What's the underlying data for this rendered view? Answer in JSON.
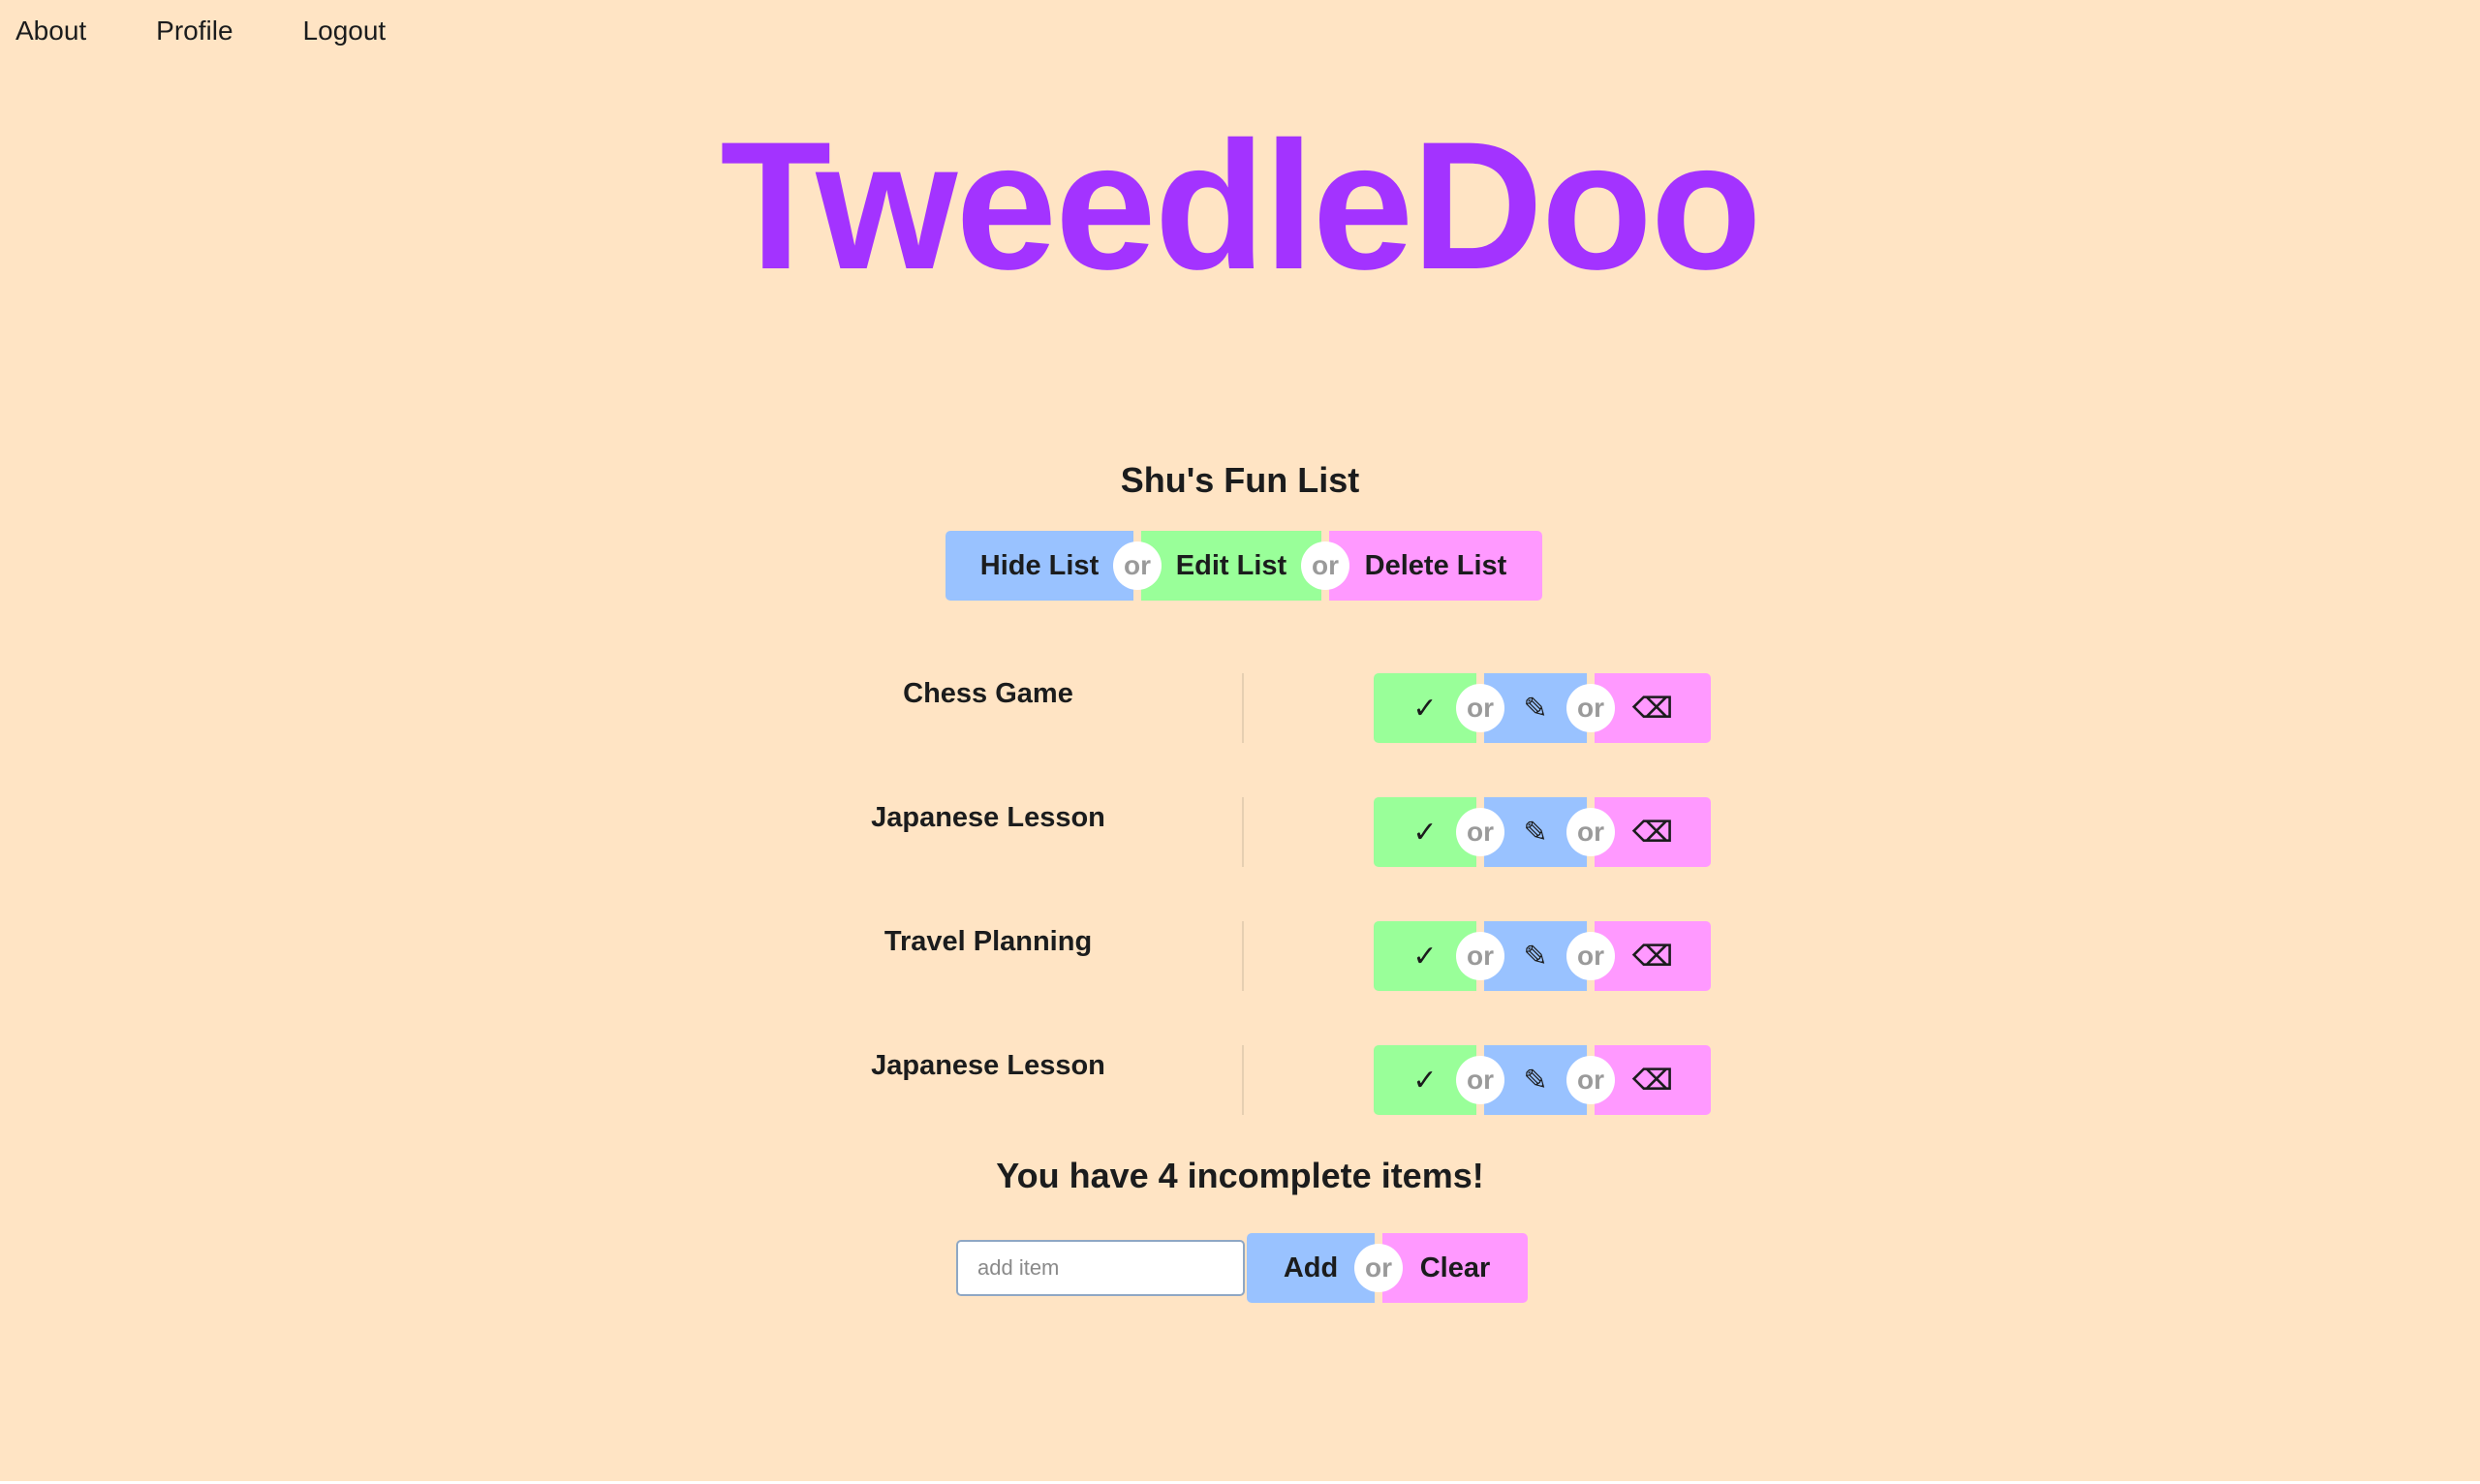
{
  "nav": {
    "about": "About",
    "profile": "Profile",
    "logout": "Logout"
  },
  "app_title": "TweedleDoo",
  "list": {
    "title": "Shu's Fun List",
    "hide_label": "Hide List",
    "edit_label": "Edit List",
    "delete_label": "Delete List",
    "or_label": "or"
  },
  "items": [
    {
      "name": "Chess Game"
    },
    {
      "name": "Japanese Lesson"
    },
    {
      "name": "Travel Planning"
    },
    {
      "name": "Japanese Lesson"
    }
  ],
  "item_actions": {
    "complete_glyph": "✓",
    "edit_glyph": "✎",
    "delete_glyph": "⌫",
    "or_label": "or"
  },
  "summary": "You have 4 incomplete items!",
  "add": {
    "placeholder": "add item",
    "value": "",
    "add_label": "Add",
    "clear_label": "Clear",
    "or_label": "or"
  },
  "colors": {
    "background": "#ffe4c4",
    "title": "#a333ff",
    "blue": "#99c2ff",
    "green": "#99ff99",
    "pink": "#ff99ff"
  },
  "icons": {
    "complete": "check-icon",
    "edit": "pencil-icon",
    "delete": "backspace-icon"
  }
}
